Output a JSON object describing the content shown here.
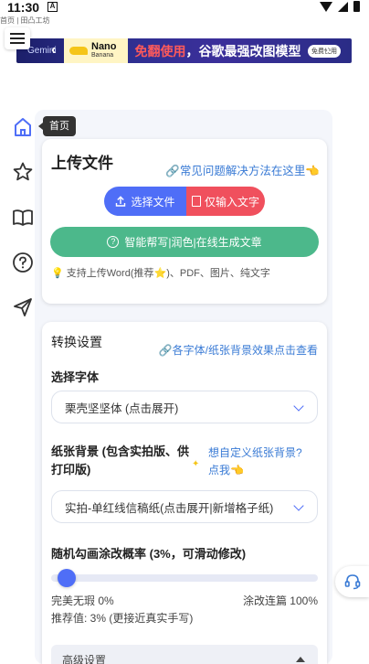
{
  "status_bar": {
    "time": "11:30",
    "app_icon": "A"
  },
  "page_tab_title": "首页 | 田凸工坊",
  "banner": {
    "left_brand": "Gemini",
    "nano_line1": "Nano",
    "nano_line2": "Banana",
    "text_white1": "免翻使用",
    "text_white2": "，谷歌最强改图模型",
    "cta": "免费使用",
    "prev_arrow": "‹",
    "next_arrow": "›"
  },
  "sidebar": {
    "tooltip": "首页",
    "items": [
      "home-icon",
      "star-icon",
      "book-icon",
      "help-icon",
      "send-icon"
    ]
  },
  "upload": {
    "title": "上传文件",
    "faq_link": "🔗常见问题解决方法在这里👈",
    "select_file_label": "选择文件",
    "text_only_label": "仅输入文字",
    "ai_button_label": "智能帮写|润色|在线生成文章",
    "support_text": "💡 支持上传Word(推荐⭐)、PDF、图片、纯文字"
  },
  "settings": {
    "title": "转换设置",
    "effects_link": "🔗各字体/纸张背景效果点击查看",
    "font_label": "选择字体",
    "font_value": "栗壳坚坚体 (点击展开)",
    "paper_label": "纸张背景 (包含实拍版、供打印版)",
    "paper_link": "想自定义纸张背景?点我👈",
    "paper_value": "实拍-单红线信稿纸(点击展开|新增格子纸)",
    "slider_label": "随机勾画涂改概率 (3%，可滑动修改)",
    "slider_value": 3,
    "slider_min_label": "完美无瑕 0%",
    "slider_max_label": "涂改连篇 100%",
    "recommend_text": "推荐值: 3% (更接近真实手写)",
    "advanced_label": "高级设置"
  },
  "colors": {
    "accent_blue": "#4f6ef7",
    "accent_red": "#f0505d",
    "accent_green": "#4cb88b",
    "link_blue": "#3a7bd5"
  }
}
